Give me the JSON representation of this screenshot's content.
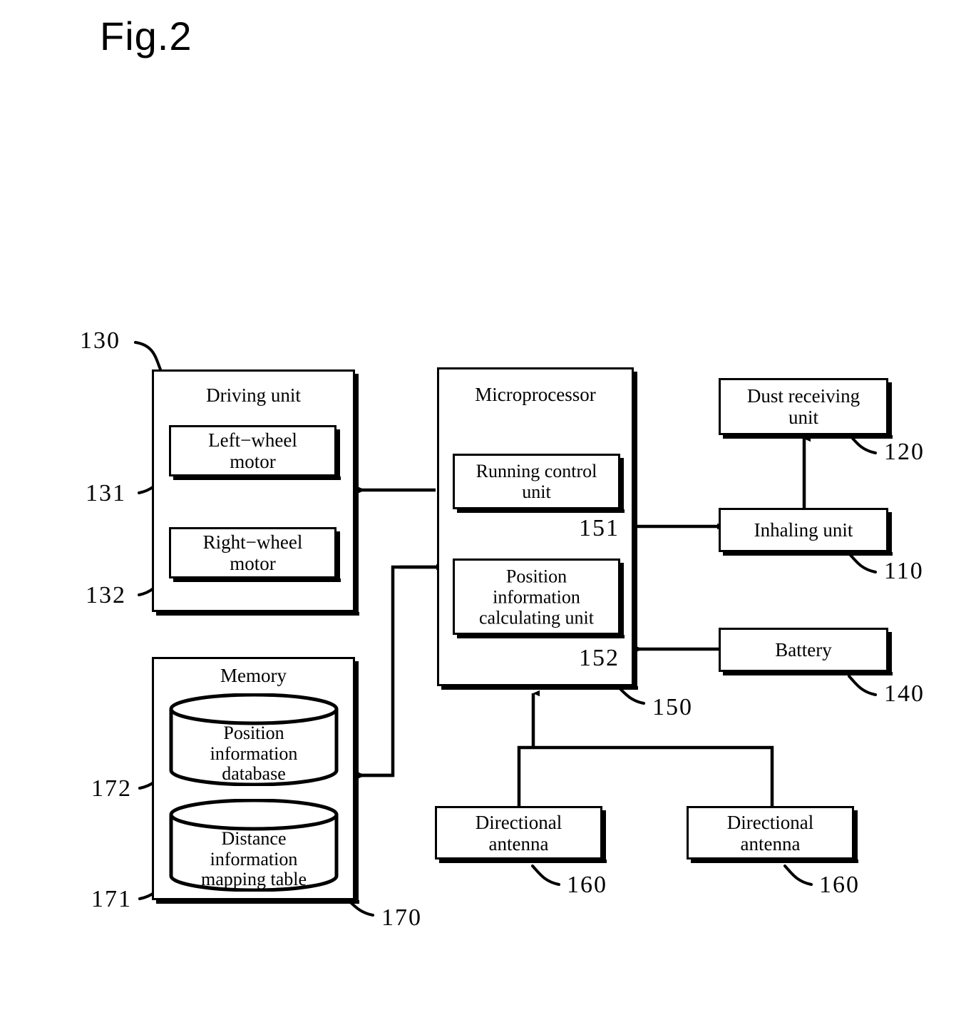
{
  "figure": {
    "title": "Fig.2",
    "type": "patent-block-diagram"
  },
  "blocks": {
    "driving_unit": {
      "title": "Driving unit",
      "ref": "130",
      "children": [
        {
          "label": "Left−wheel\nmotor",
          "line1": "Left−wheel",
          "line2": "motor",
          "ref": "131"
        },
        {
          "label": "Right−wheel\nmotor",
          "line1": "Right−wheel",
          "line2": "motor",
          "ref": "132"
        }
      ]
    },
    "microprocessor": {
      "title": "Microprocessor",
      "ref": "150",
      "children": [
        {
          "line1": "Running control",
          "line2": "unit",
          "ref": "151"
        },
        {
          "line1": "Position",
          "line2": "information",
          "line3": "calculating unit",
          "ref": "152"
        }
      ]
    },
    "memory": {
      "title": "Memory",
      "ref": "170",
      "children": [
        {
          "line1": "Position",
          "line2": "information",
          "line3": "database",
          "ref": "172"
        },
        {
          "line1": "Distance",
          "line2": "information",
          "line3": "mapping table",
          "ref": "171"
        }
      ]
    },
    "dust_receiving_unit": {
      "line1": "Dust receiving",
      "line2": "unit",
      "ref": "120"
    },
    "inhaling_unit": {
      "line1": "Inhaling unit",
      "ref": "110"
    },
    "battery": {
      "line1": "Battery",
      "ref": "140"
    },
    "antenna_left": {
      "line1": "Directional",
      "line2": "antenna",
      "ref": "160"
    },
    "antenna_right": {
      "line1": "Directional",
      "line2": "antenna",
      "ref": "160"
    }
  },
  "colors": {
    "stroke": "#000000",
    "background": "#ffffff"
  }
}
